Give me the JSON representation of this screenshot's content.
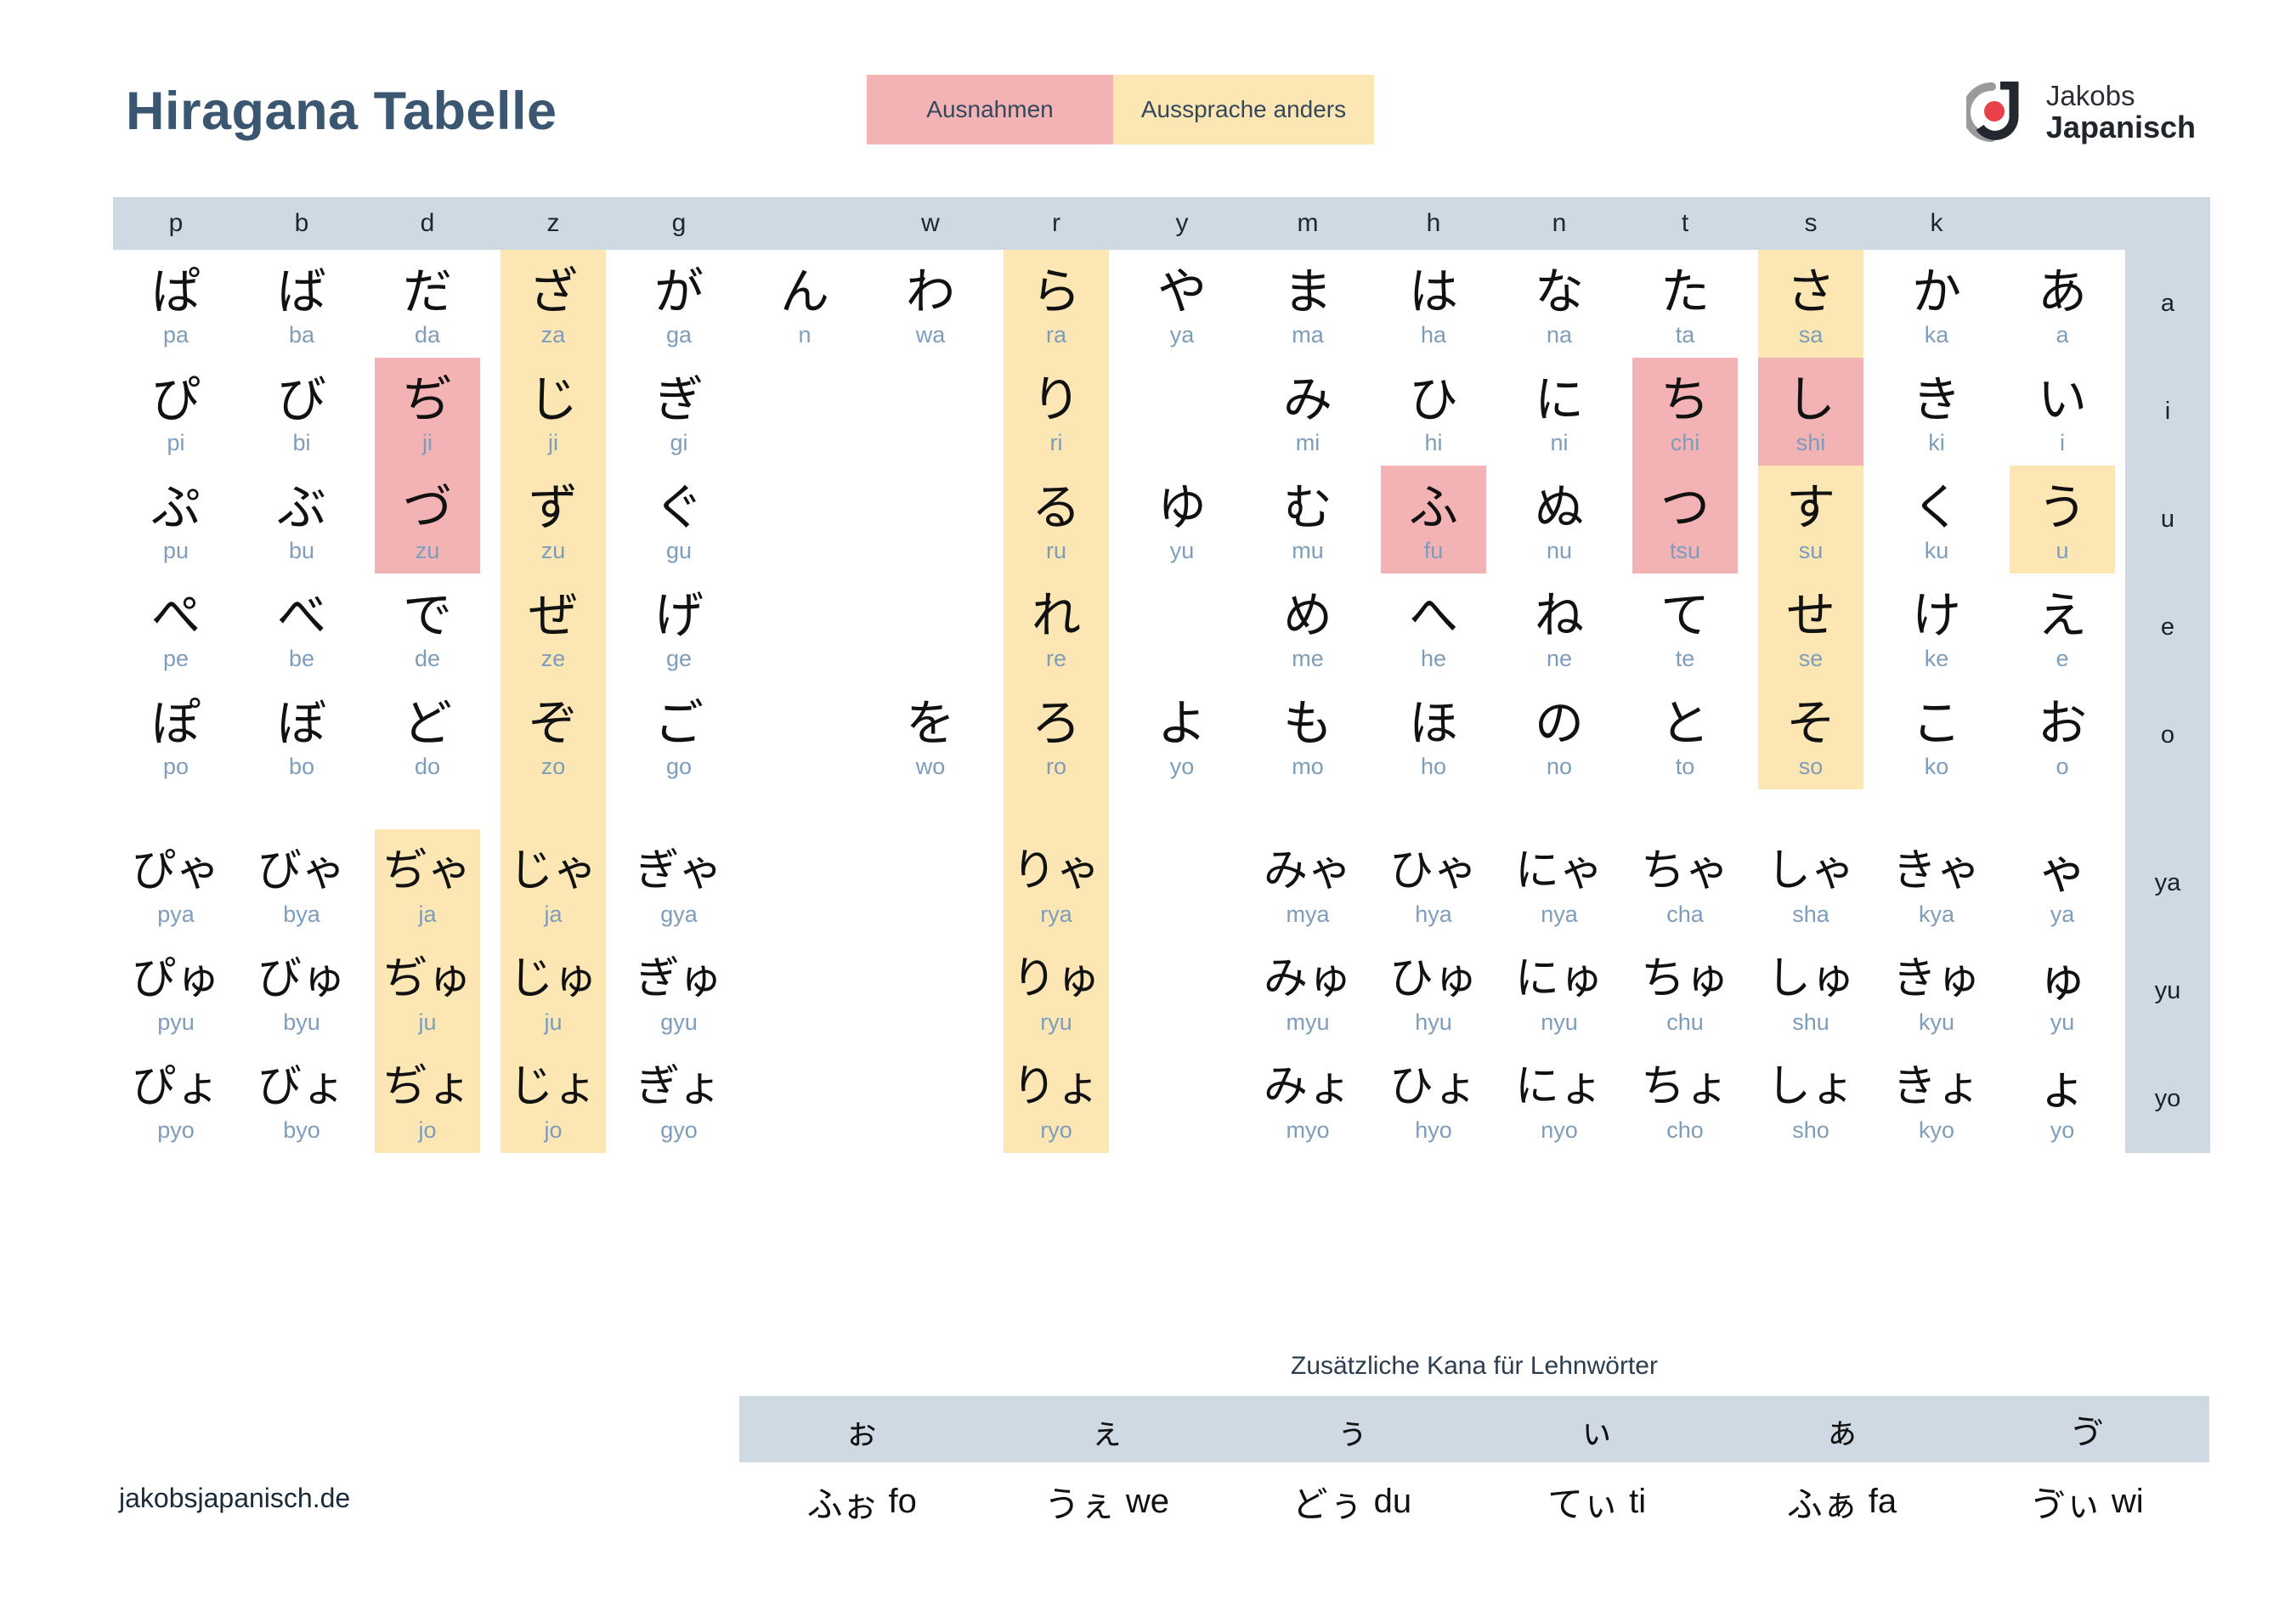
{
  "header": {
    "title": "Hiragana Tabelle",
    "legend": [
      {
        "label": "Ausnahmen",
        "color": "#f3b3b5"
      },
      {
        "label": "Aussprache anders",
        "color": "#fbe6b4"
      }
    ],
    "brand": {
      "line1": "Jakobs",
      "line2": "Japanisch",
      "dot_color": "#e8414a"
    }
  },
  "table": {
    "consonant_headers": [
      "p",
      "b",
      "d",
      "z",
      "g",
      "",
      "w",
      "r",
      "y",
      "m",
      "h",
      "n",
      "t",
      "s",
      "k",
      ""
    ],
    "vowel_labels": [
      "a",
      "i",
      "u",
      "e",
      "o",
      "ya",
      "yu",
      "yo"
    ],
    "columns": [
      {
        "key": "p",
        "cells": [
          {
            "kana": "ぱ",
            "romaji": "pa"
          },
          {
            "kana": "ぴ",
            "romaji": "pi"
          },
          {
            "kana": "ぷ",
            "romaji": "pu"
          },
          {
            "kana": "ぺ",
            "romaji": "pe"
          },
          {
            "kana": "ぽ",
            "romaji": "po"
          },
          {
            "kana": "ぴゃ",
            "romaji": "pya"
          },
          {
            "kana": "ぴゅ",
            "romaji": "pyu"
          },
          {
            "kana": "ぴょ",
            "romaji": "pyo"
          }
        ]
      },
      {
        "key": "b",
        "cells": [
          {
            "kana": "ば",
            "romaji": "ba"
          },
          {
            "kana": "び",
            "romaji": "bi"
          },
          {
            "kana": "ぶ",
            "romaji": "bu"
          },
          {
            "kana": "べ",
            "romaji": "be"
          },
          {
            "kana": "ぼ",
            "romaji": "bo"
          },
          {
            "kana": "びゃ",
            "romaji": "bya"
          },
          {
            "kana": "びゅ",
            "romaji": "byu"
          },
          {
            "kana": "びょ",
            "romaji": "byo"
          }
        ]
      },
      {
        "key": "d",
        "cells": [
          {
            "kana": "だ",
            "romaji": "da"
          },
          {
            "kana": "ぢ",
            "romaji": "ji"
          },
          {
            "kana": "づ",
            "romaji": "zu"
          },
          {
            "kana": "で",
            "romaji": "de"
          },
          {
            "kana": "ど",
            "romaji": "do"
          },
          {
            "kana": "ぢゃ",
            "romaji": "ja"
          },
          {
            "kana": "ぢゅ",
            "romaji": "ju"
          },
          {
            "kana": "ぢょ",
            "romaji": "jo"
          }
        ]
      },
      {
        "key": "z",
        "cells": [
          {
            "kana": "ざ",
            "romaji": "za"
          },
          {
            "kana": "じ",
            "romaji": "ji"
          },
          {
            "kana": "ず",
            "romaji": "zu"
          },
          {
            "kana": "ぜ",
            "romaji": "ze"
          },
          {
            "kana": "ぞ",
            "romaji": "zo"
          },
          {
            "kana": "じゃ",
            "romaji": "ja"
          },
          {
            "kana": "じゅ",
            "romaji": "ju"
          },
          {
            "kana": "じょ",
            "romaji": "jo"
          }
        ]
      },
      {
        "key": "g",
        "cells": [
          {
            "kana": "が",
            "romaji": "ga"
          },
          {
            "kana": "ぎ",
            "romaji": "gi"
          },
          {
            "kana": "ぐ",
            "romaji": "gu"
          },
          {
            "kana": "げ",
            "romaji": "ge"
          },
          {
            "kana": "ご",
            "romaji": "go"
          },
          {
            "kana": "ぎゃ",
            "romaji": "gya"
          },
          {
            "kana": "ぎゅ",
            "romaji": "gyu"
          },
          {
            "kana": "ぎょ",
            "romaji": "gyo"
          }
        ]
      },
      {
        "key": "n-syllabic",
        "cells": [
          {
            "kana": "ん",
            "romaji": "n"
          },
          {
            "kana": "",
            "romaji": ""
          },
          {
            "kana": "",
            "romaji": ""
          },
          {
            "kana": "",
            "romaji": ""
          },
          {
            "kana": "",
            "romaji": ""
          },
          {
            "kana": "",
            "romaji": ""
          },
          {
            "kana": "",
            "romaji": ""
          },
          {
            "kana": "",
            "romaji": ""
          }
        ]
      },
      {
        "key": "w",
        "cells": [
          {
            "kana": "わ",
            "romaji": "wa"
          },
          {
            "kana": "",
            "romaji": ""
          },
          {
            "kana": "",
            "romaji": ""
          },
          {
            "kana": "",
            "romaji": ""
          },
          {
            "kana": "を",
            "romaji": "wo"
          },
          {
            "kana": "",
            "romaji": ""
          },
          {
            "kana": "",
            "romaji": ""
          },
          {
            "kana": "",
            "romaji": ""
          }
        ]
      },
      {
        "key": "r",
        "cells": [
          {
            "kana": "ら",
            "romaji": "ra"
          },
          {
            "kana": "り",
            "romaji": "ri"
          },
          {
            "kana": "る",
            "romaji": "ru"
          },
          {
            "kana": "れ",
            "romaji": "re"
          },
          {
            "kana": "ろ",
            "romaji": "ro"
          },
          {
            "kana": "りゃ",
            "romaji": "rya"
          },
          {
            "kana": "りゅ",
            "romaji": "ryu"
          },
          {
            "kana": "りょ",
            "romaji": "ryo"
          }
        ]
      },
      {
        "key": "y",
        "cells": [
          {
            "kana": "や",
            "romaji": "ya"
          },
          {
            "kana": "",
            "romaji": ""
          },
          {
            "kana": "ゆ",
            "romaji": "yu"
          },
          {
            "kana": "",
            "romaji": ""
          },
          {
            "kana": "よ",
            "romaji": "yo"
          },
          {
            "kana": "",
            "romaji": ""
          },
          {
            "kana": "",
            "romaji": ""
          },
          {
            "kana": "",
            "romaji": ""
          }
        ]
      },
      {
        "key": "m",
        "cells": [
          {
            "kana": "ま",
            "romaji": "ma"
          },
          {
            "kana": "み",
            "romaji": "mi"
          },
          {
            "kana": "む",
            "romaji": "mu"
          },
          {
            "kana": "め",
            "romaji": "me"
          },
          {
            "kana": "も",
            "romaji": "mo"
          },
          {
            "kana": "みゃ",
            "romaji": "mya"
          },
          {
            "kana": "みゅ",
            "romaji": "myu"
          },
          {
            "kana": "みょ",
            "romaji": "myo"
          }
        ]
      },
      {
        "key": "h",
        "cells": [
          {
            "kana": "は",
            "romaji": "ha"
          },
          {
            "kana": "ひ",
            "romaji": "hi"
          },
          {
            "kana": "ふ",
            "romaji": "fu"
          },
          {
            "kana": "へ",
            "romaji": "he"
          },
          {
            "kana": "ほ",
            "romaji": "ho"
          },
          {
            "kana": "ひゃ",
            "romaji": "hya"
          },
          {
            "kana": "ひゅ",
            "romaji": "hyu"
          },
          {
            "kana": "ひょ",
            "romaji": "hyo"
          }
        ]
      },
      {
        "key": "n",
        "cells": [
          {
            "kana": "な",
            "romaji": "na"
          },
          {
            "kana": "に",
            "romaji": "ni"
          },
          {
            "kana": "ぬ",
            "romaji": "nu"
          },
          {
            "kana": "ね",
            "romaji": "ne"
          },
          {
            "kana": "の",
            "romaji": "no"
          },
          {
            "kana": "にゃ",
            "romaji": "nya"
          },
          {
            "kana": "にゅ",
            "romaji": "nyu"
          },
          {
            "kana": "にょ",
            "romaji": "nyo"
          }
        ]
      },
      {
        "key": "t",
        "cells": [
          {
            "kana": "た",
            "romaji": "ta"
          },
          {
            "kana": "ち",
            "romaji": "chi"
          },
          {
            "kana": "つ",
            "romaji": "tsu"
          },
          {
            "kana": "て",
            "romaji": "te"
          },
          {
            "kana": "と",
            "romaji": "to"
          },
          {
            "kana": "ちゃ",
            "romaji": "cha"
          },
          {
            "kana": "ちゅ",
            "romaji": "chu"
          },
          {
            "kana": "ちょ",
            "romaji": "cho"
          }
        ]
      },
      {
        "key": "s",
        "cells": [
          {
            "kana": "さ",
            "romaji": "sa"
          },
          {
            "kana": "し",
            "romaji": "shi"
          },
          {
            "kana": "す",
            "romaji": "su"
          },
          {
            "kana": "せ",
            "romaji": "se"
          },
          {
            "kana": "そ",
            "romaji": "so"
          },
          {
            "kana": "しゃ",
            "romaji": "sha"
          },
          {
            "kana": "しゅ",
            "romaji": "shu"
          },
          {
            "kana": "しょ",
            "romaji": "sho"
          }
        ]
      },
      {
        "key": "k",
        "cells": [
          {
            "kana": "か",
            "romaji": "ka"
          },
          {
            "kana": "き",
            "romaji": "ki"
          },
          {
            "kana": "く",
            "romaji": "ku"
          },
          {
            "kana": "け",
            "romaji": "ke"
          },
          {
            "kana": "こ",
            "romaji": "ko"
          },
          {
            "kana": "きゃ",
            "romaji": "kya"
          },
          {
            "kana": "きゅ",
            "romaji": "kyu"
          },
          {
            "kana": "きょ",
            "romaji": "kyo"
          }
        ]
      },
      {
        "key": "vowel",
        "cells": [
          {
            "kana": "あ",
            "romaji": "a"
          },
          {
            "kana": "い",
            "romaji": "i"
          },
          {
            "kana": "う",
            "romaji": "u"
          },
          {
            "kana": "え",
            "romaji": "e"
          },
          {
            "kana": "お",
            "romaji": "o"
          },
          {
            "kana": "ゃ",
            "romaji": "ya"
          },
          {
            "kana": "ゅ",
            "romaji": "yu"
          },
          {
            "kana": "ょ",
            "romaji": "yo"
          }
        ]
      }
    ]
  },
  "loanwords": {
    "title": "Zusätzliche Kana für Lehnwörter",
    "small_kana": [
      "ぉ",
      "ぇ",
      "ぅ",
      "ぃ",
      "ぁ",
      "ゔ"
    ],
    "examples": [
      {
        "kana": "ふぉ",
        "romaji": "fo"
      },
      {
        "kana": "うぇ",
        "romaji": "we"
      },
      {
        "kana": "どぅ",
        "romaji": "du"
      },
      {
        "kana": "てぃ",
        "romaji": "ti"
      },
      {
        "kana": "ふぁ",
        "romaji": "fa"
      },
      {
        "kana": "ゔぃ",
        "romaji": "wi"
      }
    ]
  },
  "footer": {
    "url": "jakobsjapanisch.de"
  }
}
